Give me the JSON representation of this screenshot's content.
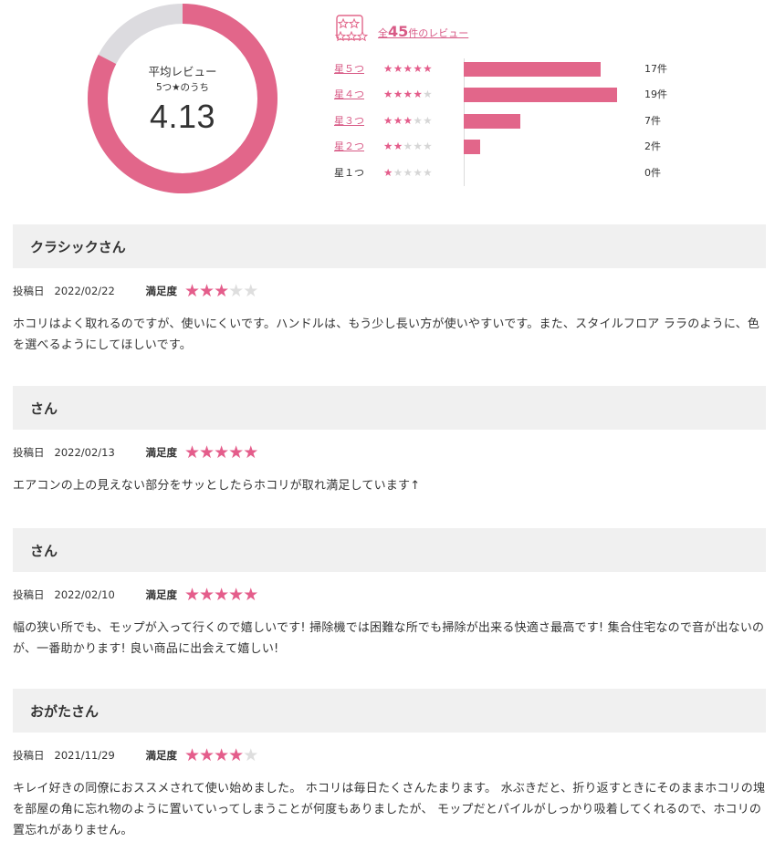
{
  "summary": {
    "title": "平均レビュー",
    "subtitle": "5つ★のうち",
    "average": "4.13",
    "average_value": 4.13,
    "max": 5,
    "ring_color": "#e2668a",
    "ring_bg": "#dcdbdf",
    "total_prefix": "全",
    "total_count": "45",
    "total_suffix": "件のレビュー",
    "distribution": [
      {
        "label": "星５つ",
        "stars": 5,
        "count": 17,
        "count_text": "17件",
        "linked": true
      },
      {
        "label": "星４つ",
        "stars": 4,
        "count": 19,
        "count_text": "19件",
        "linked": true
      },
      {
        "label": "星３つ",
        "stars": 3,
        "count": 7,
        "count_text": "7件",
        "linked": true
      },
      {
        "label": "星２つ",
        "stars": 2,
        "count": 2,
        "count_text": "2件",
        "linked": true
      },
      {
        "label": "星１つ",
        "stars": 1,
        "count": 0,
        "count_text": "0件",
        "linked": false
      }
    ]
  },
  "labels": {
    "posted": "投稿日",
    "satisfaction": "満足度"
  },
  "reviews": [
    {
      "name": "クラシックさん",
      "date": "2022/02/22",
      "rating": 3,
      "body": "ホコリはよく取れるのですが、使いにくいです。ハンドルは、もう少し長い方が使いやすいです。また、スタイルフロア ララのように、色を選べるようにしてほしいです。"
    },
    {
      "name": "さん",
      "date": "2022/02/13",
      "rating": 5,
      "body": "エアコンの上の見えない部分をサッとしたらホコリが取れ満足しています↑"
    },
    {
      "name": "さん",
      "date": "2022/02/10",
      "rating": 5,
      "body": "幅の狭い所でも、モップが入って行くので嬉しいです! 掃除機では困難な所でも掃除が出来る快適さ最高です! 集合住宅なので音が出ないのが、一番助かります! 良い商品に出会えて嬉しい!"
    },
    {
      "name": "おがたさん",
      "date": "2021/11/29",
      "rating": 4,
      "body": "キレイ好きの同僚におススメされて使い始めました。 ホコリは毎日たくさんたまります。 水ぶきだと、折り返すときにそのままホコリの塊を部屋の角に忘れ物のように置いていってしまうことが何度もありましたが、 モップだとパイルがしっかり吸着してくれるので、ホコリの置忘れがありません。"
    }
  ]
}
